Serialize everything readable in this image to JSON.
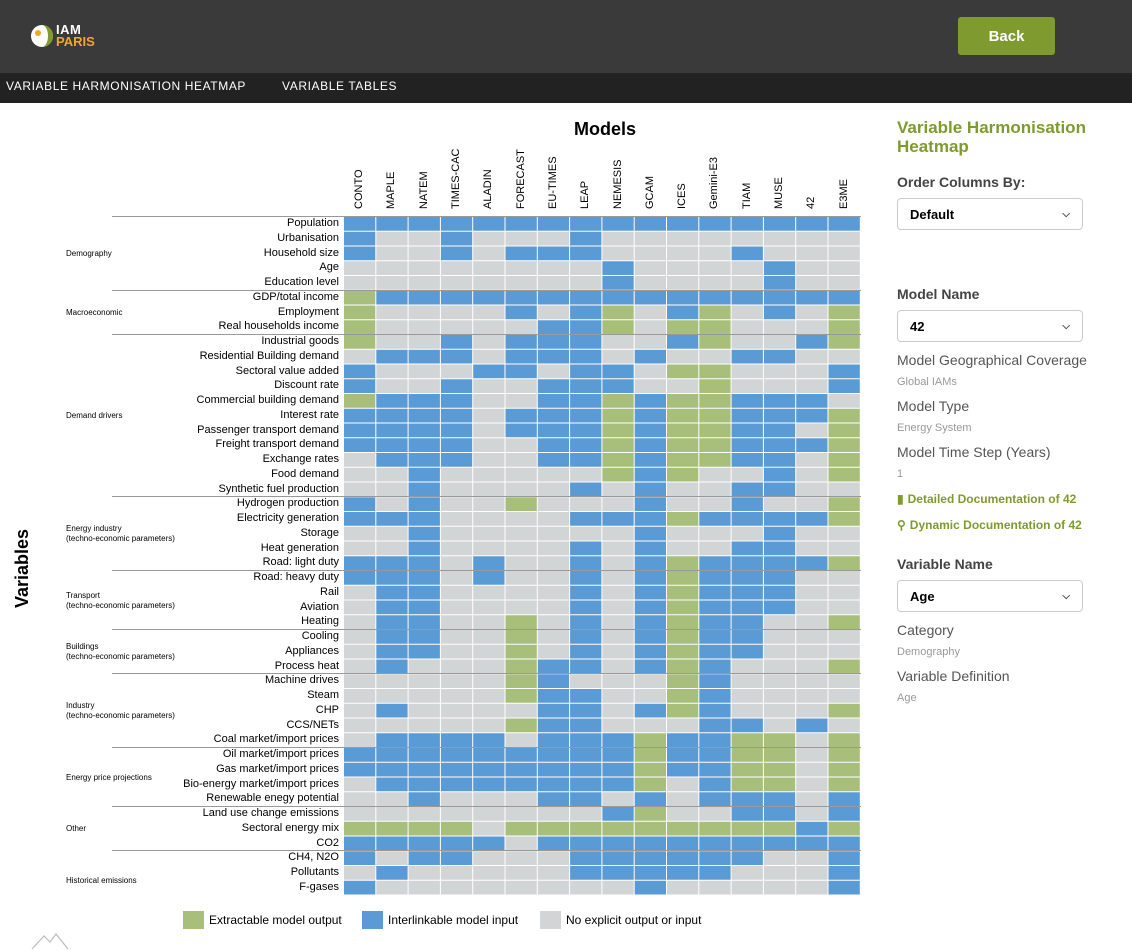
{
  "header": {
    "logo_iam": "IAM",
    "logo_paris": "PARIS",
    "back_label": "Back"
  },
  "nav": {
    "items": [
      "VARIABLE HARMONISATION HEATMAP",
      "VARIABLE TABLES"
    ]
  },
  "heatmap": {
    "models_title": "Models",
    "variables_title": "Variables",
    "colors": {
      "output": "#a8bf7b",
      "input": "#5b9bd5",
      "none": "#d2d5d6"
    },
    "models": [
      "CONTO",
      "MAPLE",
      "NATEM",
      "TIMES-CAC",
      "ALADIN",
      "FORECAST",
      "EU-TIMES",
      "LEAP",
      "NEMESIS",
      "GCAM",
      "ICES",
      "Gemini-E3",
      "TIAM",
      "MUSE",
      "42",
      "E3ME"
    ],
    "categories": [
      {
        "label": "Demography",
        "rows": 5
      },
      {
        "label": "Macroeconomic",
        "rows": 3
      },
      {
        "label": "Demand drivers",
        "rows": 11
      },
      {
        "label": "Energy industry\n(techno-economic parameters)",
        "rows": 5
      },
      {
        "label": "Transport\n(techno-economic parameters)",
        "rows": 4
      },
      {
        "label": "Buildings\n(techno-economic parameters)",
        "rows": 3
      },
      {
        "label": "Industry\n(techno-economic parameters)",
        "rows": 5
      },
      {
        "label": "Energy price projections",
        "rows": 4
      },
      {
        "label": "Other",
        "rows": 3
      },
      {
        "label": "Historical emissions",
        "rows": 4
      }
    ],
    "variables": [
      {
        "name": "Population",
        "cells": "IIIIIIIIIIIIIIII"
      },
      {
        "name": "Urbanisation",
        "cells": "I..I...I........"
      },
      {
        "name": "Household size",
        "cells": "I..I.III....I..."
      },
      {
        "name": "Age",
        "cells": "........I....I.."
      },
      {
        "name": "Education level",
        "cells": "........I....I.."
      },
      {
        "name": "GDP/total income",
        "cells": "OIIIIIIIIIIIIIII"
      },
      {
        "name": "Employment",
        "cells": "O....I.IO.IO.I.O"
      },
      {
        "name": "Real households income",
        "cells": "O.....IIO.OO...O"
      },
      {
        "name": "Industrial goods",
        "cells": "O..I.III..IO..IO"
      },
      {
        "name": "Residential Building demand",
        "cells": ".III.III.I..II.."
      },
      {
        "name": "Sectoral value added",
        "cells": "I...II.II.OO...I"
      },
      {
        "name": "Discount rate",
        "cells": "I..I..III..O...I"
      },
      {
        "name": "Commercial building demand",
        "cells": "OIII..IIOIOOIII."
      },
      {
        "name": "Interest rate",
        "cells": "IIII.IIIOIOOIIIO"
      },
      {
        "name": "Passenger transport demand",
        "cells": "IIII.IIIOIOOII.O"
      },
      {
        "name": "Freight transport demand",
        "cells": "IIII..IIOIOOIIIO"
      },
      {
        "name": "Exchange rates",
        "cells": ".III..IIOIOOII.O"
      },
      {
        "name": "Food demand",
        "cells": "..I.....OIO..I.O"
      },
      {
        "name": "Synthetic fuel production",
        "cells": "..I....I.I..II.."
      },
      {
        "name": "Hydrogen production",
        "cells": "I.I..O...I..I..O"
      },
      {
        "name": "Electricity generation",
        "cells": "III....IIIOIIIIO"
      },
      {
        "name": "Storage",
        "cells": "..I......I...I.."
      },
      {
        "name": "Heat generation",
        "cells": "..I....I.I..II.."
      },
      {
        "name": "Road: light duty",
        "cells": "III.I..I.IOIIIIO"
      },
      {
        "name": "Road: heavy duty",
        "cells": "III.I..I.IOIII.."
      },
      {
        "name": "Rail",
        "cells": ".II....I.IOIII.."
      },
      {
        "name": "Aviation",
        "cells": ".II....I.IOIII.."
      },
      {
        "name": "Heating",
        "cells": ".II..O.I.IOII..O"
      },
      {
        "name": "Cooling",
        "cells": ".II..O.I.IOII..."
      },
      {
        "name": "Appliances",
        "cells": ".II..O.I.IOII..."
      },
      {
        "name": "Process heat",
        "cells": ".I...OII.IOI...O"
      },
      {
        "name": "Machine drives",
        "cells": ".....OI...OI...."
      },
      {
        "name": "Steam",
        "cells": ".....OII..OI...."
      },
      {
        "name": "CHP",
        "cells": ".I....II.IOI...O"
      },
      {
        "name": "CCS/NETs",
        "cells": ".....OII...II.I."
      },
      {
        "name": "Coal market/import prices",
        "cells": ".IIII.IIIOIIOO.O"
      },
      {
        "name": "Oil market/import prices",
        "cells": "IIIIIIIIIOIIOO.O"
      },
      {
        "name": "Gas market/import prices",
        "cells": "IIIIIIIIIOIIOO.O"
      },
      {
        "name": "Bio-energy market/import prices",
        "cells": ".IIIIIIIIO.IOO.O"
      },
      {
        "name": "Renewable enegy potential",
        "cells": "..I...II.I.III.I"
      },
      {
        "name": "Land use change emissions",
        "cells": "........IO..II.I"
      },
      {
        "name": "Sectoral energy mix",
        "cells": "OOOO.OOOOOOOOOIO"
      },
      {
        "name": "CO2",
        "cells": "IIIII.IIIIIIIIII"
      },
      {
        "name": "CH4, N2O",
        "cells": "I.II...IIIIII..I"
      },
      {
        "name": "Pollutants",
        "cells": ".I.....IIIII...I"
      },
      {
        "name": "F-gases",
        "cells": "I........I.....I"
      }
    ],
    "legend": [
      {
        "label": "Extractable model output",
        "color": "#a8bf7b"
      },
      {
        "label": "Interlinkable model input",
        "color": "#5b9bd5"
      },
      {
        "label": "No explicit output or input",
        "color": "#d2d5d6"
      }
    ]
  },
  "sidebar": {
    "title": "Variable Harmonisation Heatmap",
    "order_label": "Order Columns By:",
    "order_value": "Default",
    "model_name_label": "Model Name",
    "model_name_value": "42",
    "coverage_label": "Model Geographical Coverage",
    "coverage_value": "Global IAMs",
    "type_label": "Model Type",
    "type_value": "Energy System",
    "timestep_label": "Model Time Step (Years)",
    "timestep_value": "1",
    "detailed_doc": "Detailed Documentation of 42",
    "dynamic_doc": "Dynamic Documentation of 42",
    "variable_name_label": "Variable Name",
    "variable_name_value": "Age",
    "category_label": "Category",
    "category_value": "Demography",
    "definition_label": "Variable Definition",
    "definition_value": "Age"
  }
}
